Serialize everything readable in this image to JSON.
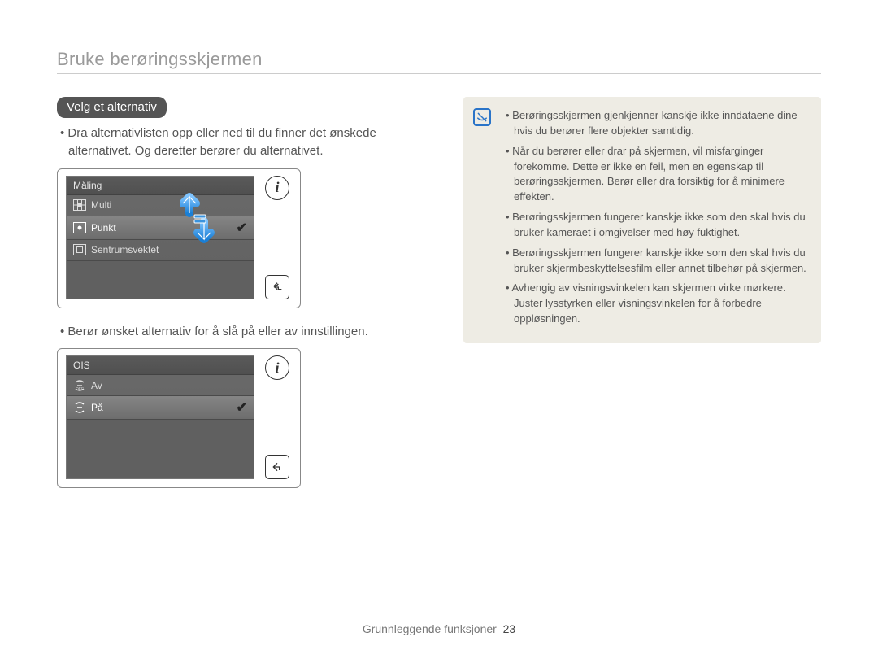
{
  "header": "Bruke berøringsskjermen",
  "section_pill": "Velg et alternativ",
  "instruction1": "Dra alternativlisten opp eller ned til du finner det ønskede alternativet. Og deretter berører du alternativet.",
  "instruction2": "Berør ønsket alternativ for å slå på eller av innstillingen.",
  "lcd1": {
    "title": "Måling",
    "rows": [
      {
        "label": "Multi",
        "selected": false
      },
      {
        "label": "Punkt",
        "selected": true
      },
      {
        "label": "Sentrumsvektet",
        "selected": false
      }
    ]
  },
  "lcd2": {
    "title": "OIS",
    "rows": [
      {
        "label": "Av",
        "selected": false
      },
      {
        "label": "På",
        "selected": true
      }
    ]
  },
  "notes": [
    "Berøringsskjermen gjenkjenner kanskje ikke inndataene dine hvis du berører flere objekter samtidig.",
    "Når du berører eller drar på skjermen, vil misfarginger forekomme. Dette er ikke en feil, men en egenskap til berøringsskjermen. Berør eller dra forsiktig for å minimere effekten.",
    "Berøringsskjermen fungerer kanskje ikke som den skal hvis du bruker kameraet i omgivelser med høy fuktighet.",
    "Berøringsskjermen fungerer kanskje ikke som den skal hvis du bruker skjermbeskyttelsesfilm eller annet tilbehør på skjermen.",
    "Avhengig av visningsvinkelen kan skjermen virke mørkere. Juster lysstyrken eller visningsvinkelen for å forbedre oppløsningen."
  ],
  "footer_label": "Grunnleggende funksjoner",
  "footer_page": "23",
  "info_glyph": "i"
}
